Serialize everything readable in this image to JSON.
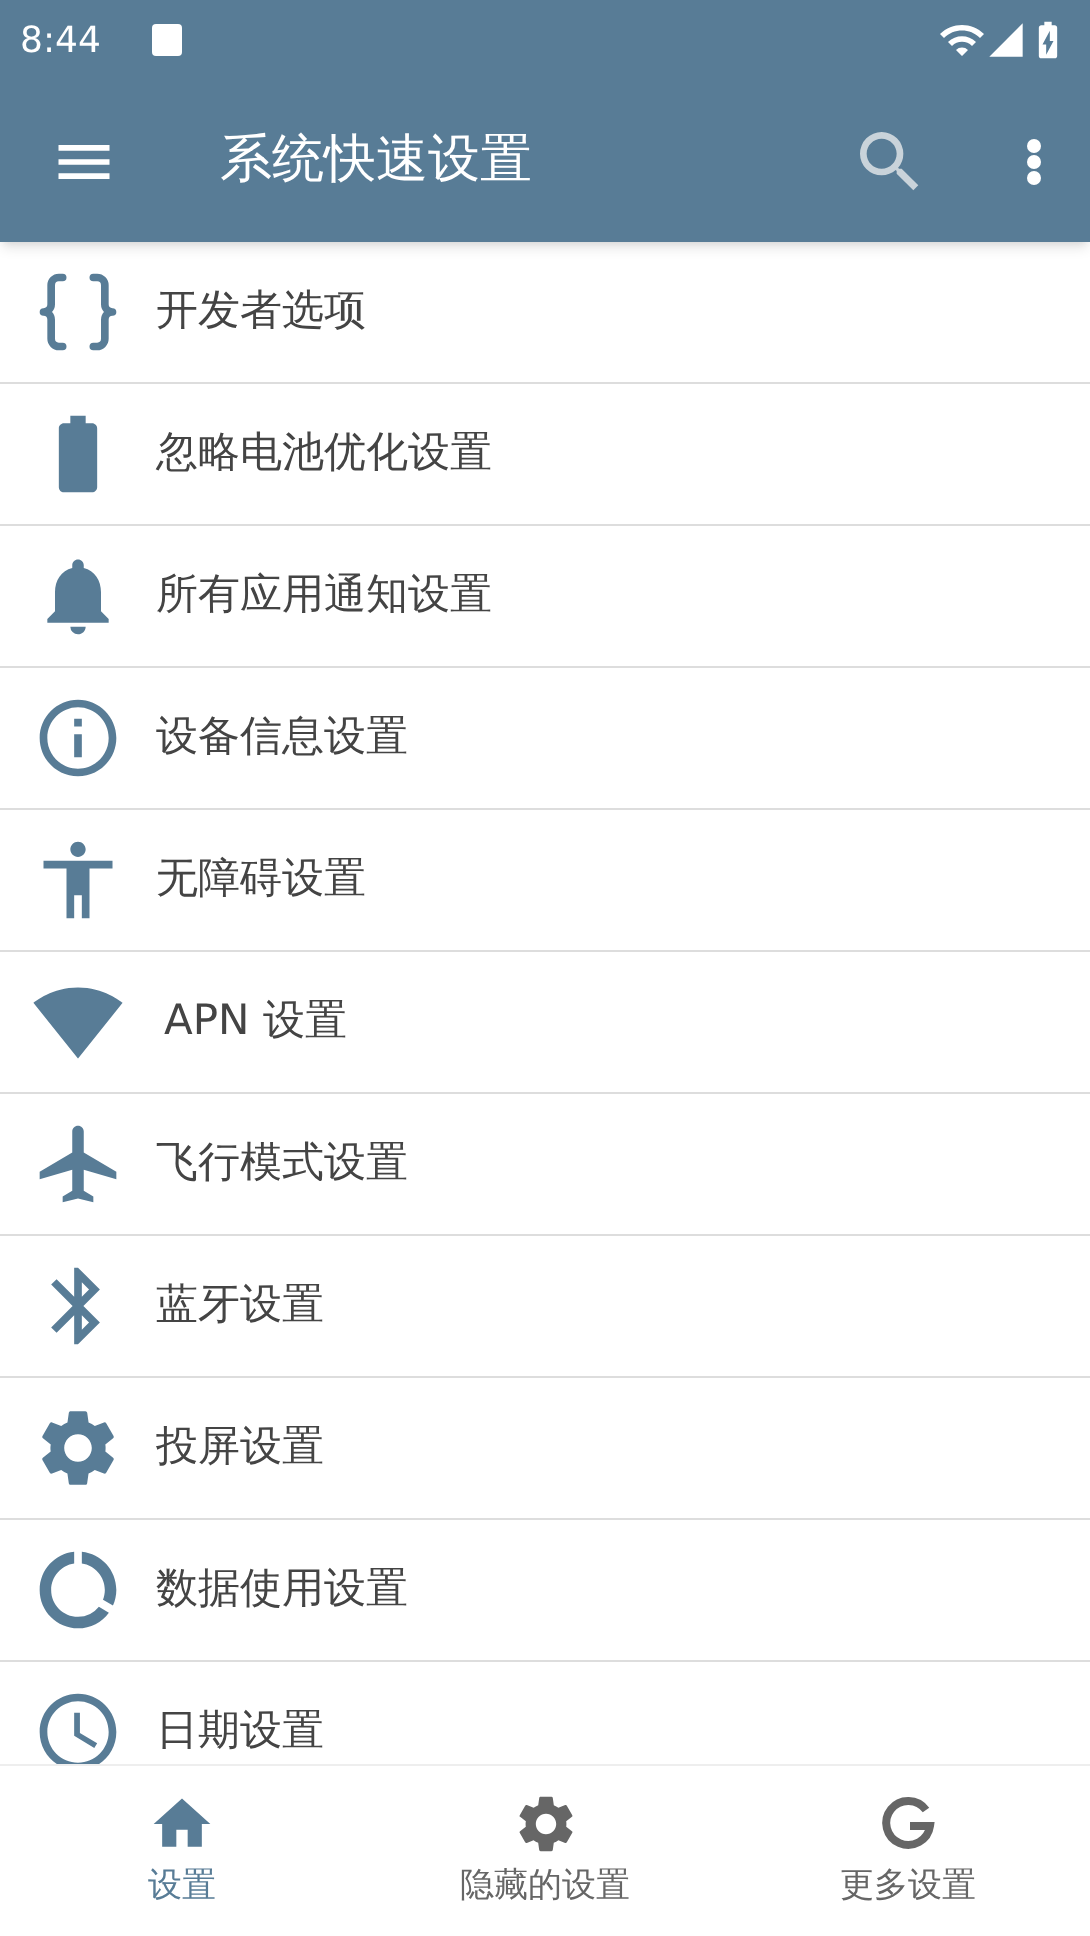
{
  "status_bar": {
    "time": "8:44"
  },
  "toolbar": {
    "title": "系统快速设置"
  },
  "items": [
    {
      "kind": "braces",
      "label": "开发者选项"
    },
    {
      "kind": "battery",
      "label": "忽略电池优化设置"
    },
    {
      "kind": "bell",
      "label": "所有应用通知设置"
    },
    {
      "kind": "info",
      "label": "设备信息设置"
    },
    {
      "kind": "accessibility",
      "label": "无障碍设置"
    },
    {
      "kind": "wifi",
      "label": "APN 设置"
    },
    {
      "kind": "plane",
      "label": "飞行模式设置"
    },
    {
      "kind": "bluetooth",
      "label": "蓝牙设置"
    },
    {
      "kind": "gear",
      "label": "投屏设置"
    },
    {
      "kind": "data",
      "label": "数据使用设置"
    },
    {
      "kind": "clock",
      "label": "日期设置"
    }
  ],
  "bottom_nav": [
    {
      "kind": "home",
      "label": "设置",
      "selected": true
    },
    {
      "kind": "gear",
      "label": "隐藏的设置",
      "selected": false
    },
    {
      "kind": "g",
      "label": "更多设置",
      "selected": false
    }
  ]
}
